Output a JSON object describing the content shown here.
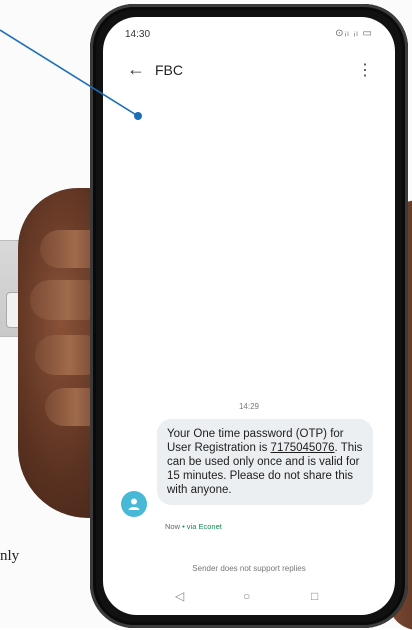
{
  "background": {
    "bottom_text": "nly"
  },
  "status_bar": {
    "time": "14:30",
    "icons": "⊙ᵢₗ ᵢₗ ▭"
  },
  "app_bar": {
    "contact": "FBC",
    "back_glyph": "←",
    "more_glyph": "⋮"
  },
  "conversation": {
    "message_time": "14:29",
    "message_before_code": "Your One time password (OTP) for User Registration is ",
    "otp_code": "7175045076",
    "message_after_code": ". This can be used only once and is valid for 15 minutes. Please do not share this with anyone.",
    "meta_now": "Now",
    "meta_via": " • via Econet"
  },
  "footer": {
    "note": "Sender does not support replies"
  },
  "nav": {
    "back": "◁",
    "home": "○",
    "recents": "□"
  },
  "colors": {
    "pointer": "#1c6db8",
    "avatar": "#47b8d6",
    "bubble": "#eceff1",
    "via": "#1a8a52"
  }
}
